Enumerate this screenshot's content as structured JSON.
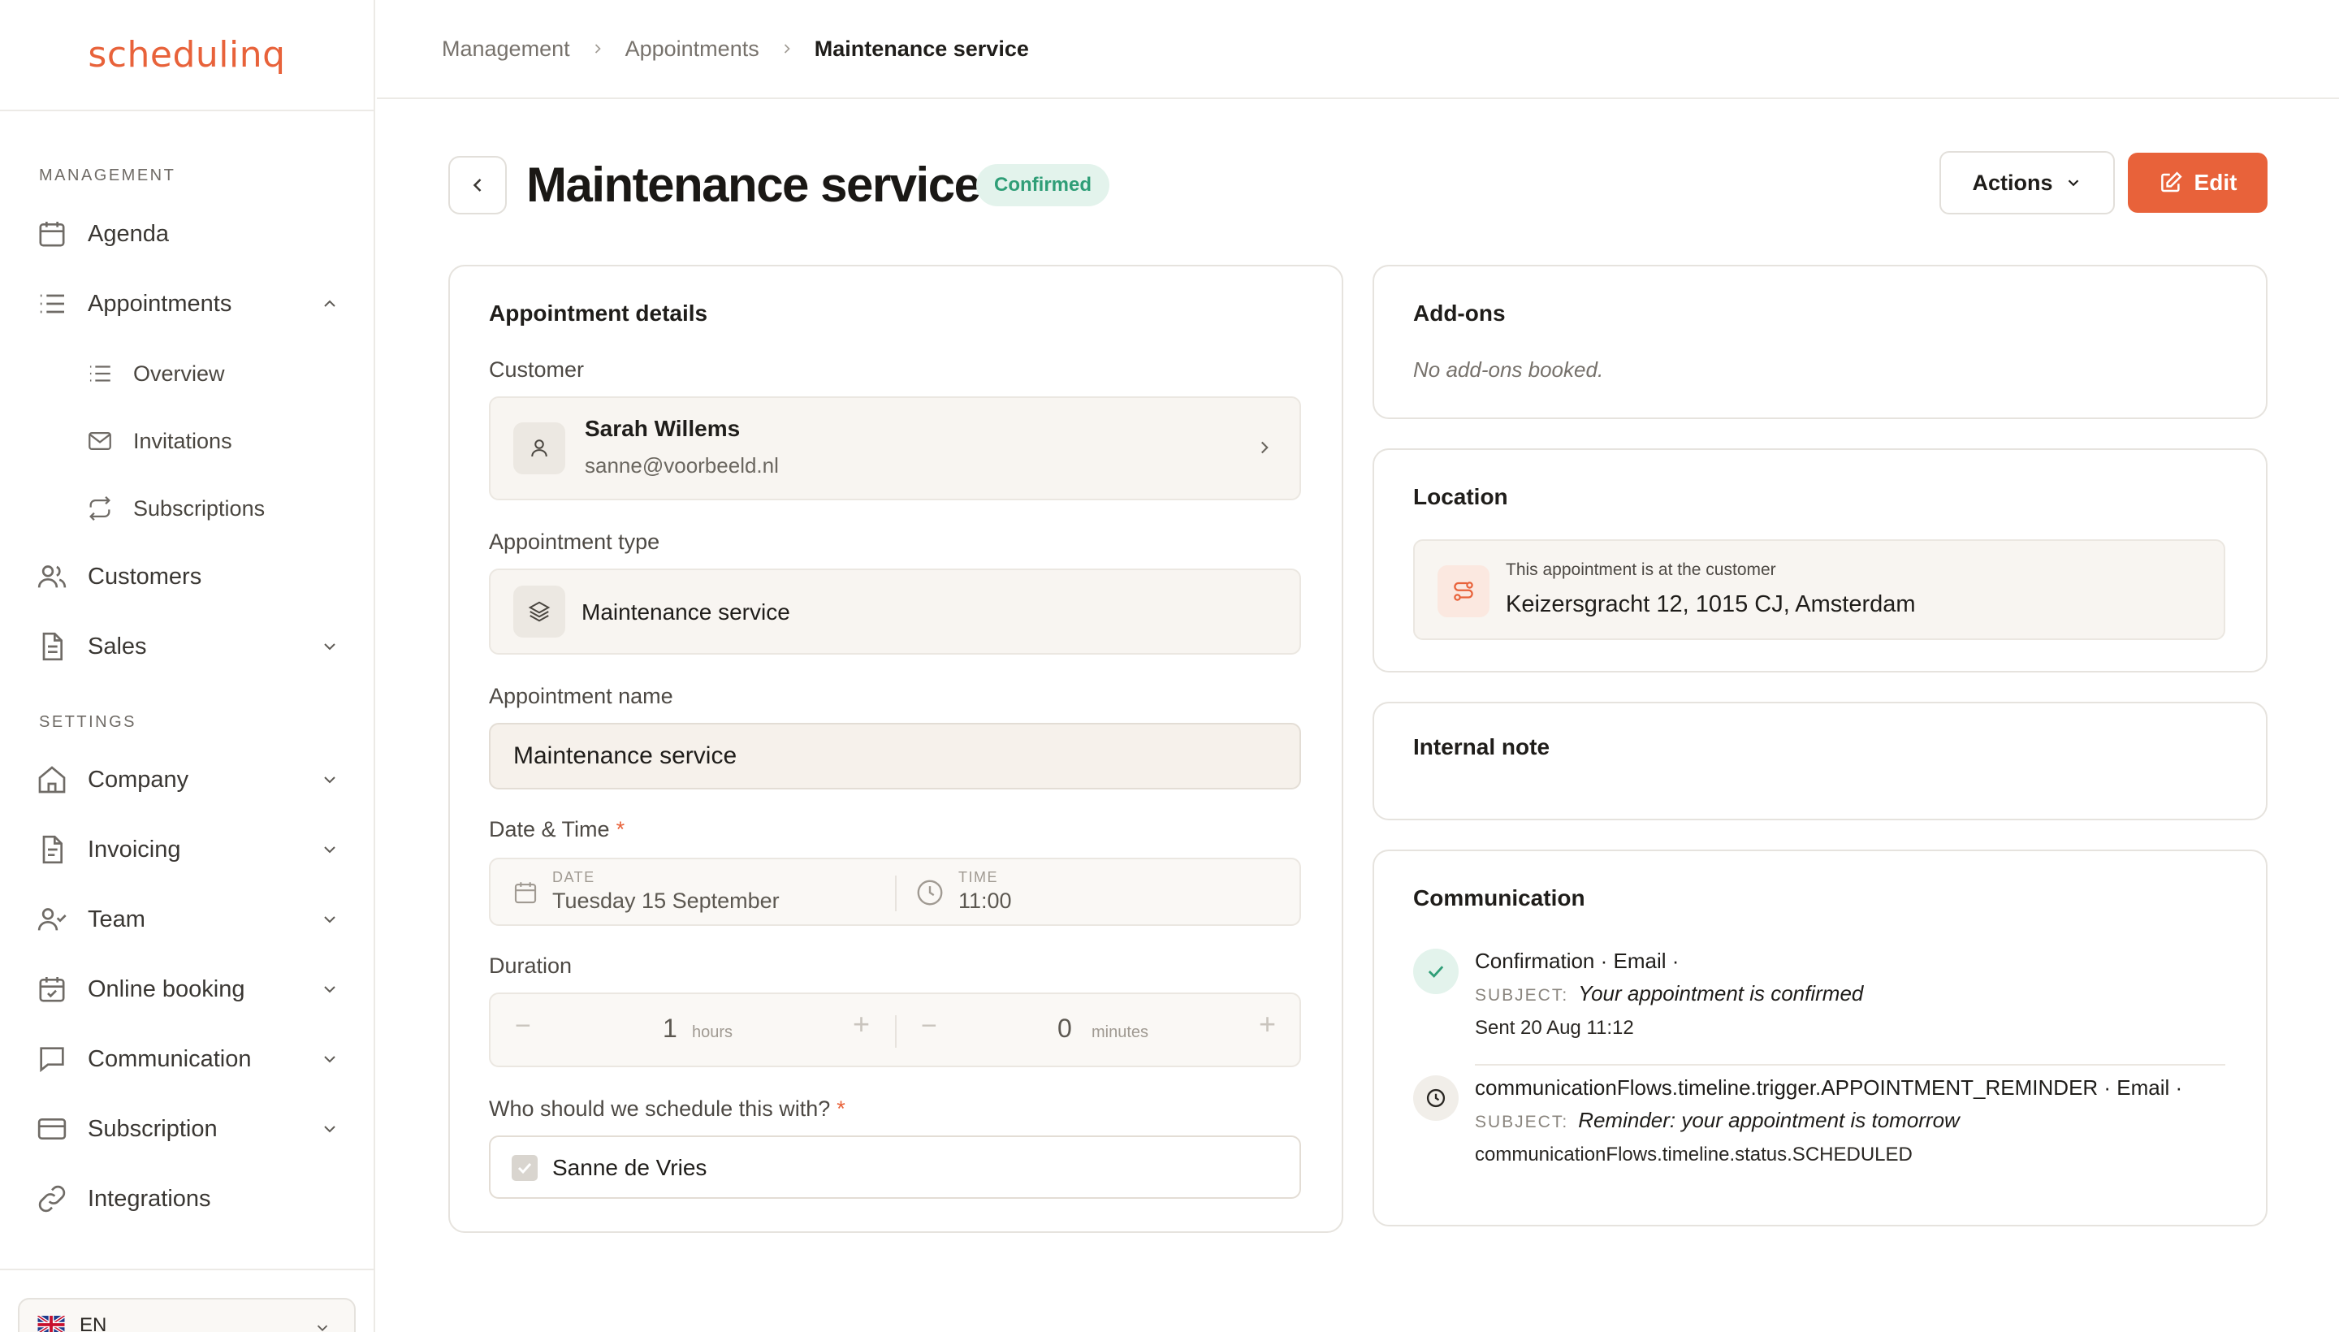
{
  "brand": {
    "logo_text": "schedulinq",
    "accent": "#e8623a"
  },
  "sidebar": {
    "management_label": "MANAGEMENT",
    "settings_label": "SETTINGS",
    "items": {
      "agenda": "Agenda",
      "appointments": "Appointments",
      "overview": "Overview",
      "invitations": "Invitations",
      "subscriptions": "Subscriptions",
      "customers": "Customers",
      "sales": "Sales",
      "company": "Company",
      "invoicing": "Invoicing",
      "team": "Team",
      "online_booking": "Online booking",
      "communication": "Communication",
      "subscription": "Subscription",
      "integrations": "Integrations"
    },
    "language": "EN"
  },
  "breadcrumb": [
    "Management",
    "Appointments",
    "Maintenance service"
  ],
  "page": {
    "title": "Maintenance service",
    "status": "Confirmed",
    "actions_label": "Actions",
    "edit_label": "Edit"
  },
  "details": {
    "title": "Appointment details",
    "customer_label": "Customer",
    "customer_name": "Sarah Willems",
    "customer_email": "sanne@voorbeeld.nl",
    "type_label": "Appointment type",
    "type_value": "Maintenance service",
    "name_label": "Appointment name",
    "name_value": "Maintenance service",
    "datetime_label": "Date & Time",
    "required_mark": "*",
    "date_caption": "DATE",
    "date_value": "Tuesday 15 September",
    "time_caption": "TIME",
    "time_value": "11:00",
    "duration_label": "Duration",
    "hours_value": "1",
    "hours_unit": "hours",
    "minutes_value": "0",
    "minutes_unit": "minutes",
    "minus": "−",
    "plus": "+",
    "schedule_with_label": "Who should we schedule this with?",
    "schedule_with_value": "Sanne de Vries",
    "schedule_with_checked": true
  },
  "addons": {
    "title": "Add-ons",
    "empty": "No add-ons booked."
  },
  "location": {
    "title": "Location",
    "caption": "This appointment is at the customer",
    "address": "Keizersgracht 12, 1015 CJ, Amsterdam"
  },
  "note": {
    "title": "Internal note"
  },
  "communication": {
    "title": "Communication",
    "subject_label": "SUBJECT:",
    "items": [
      {
        "title": "Confirmation · Email ·",
        "subject": "Your appointment is confirmed",
        "meta": "Sent 20 Aug 11:12",
        "status_color": "#2f9e77"
      },
      {
        "title": "communicationFlows.timeline.trigger.APPOINTMENT_REMINDER · Email ·",
        "subject": "Reminder: your appointment is tomorrow",
        "meta": "communicationFlows.timeline.status.SCHEDULED"
      }
    ]
  }
}
